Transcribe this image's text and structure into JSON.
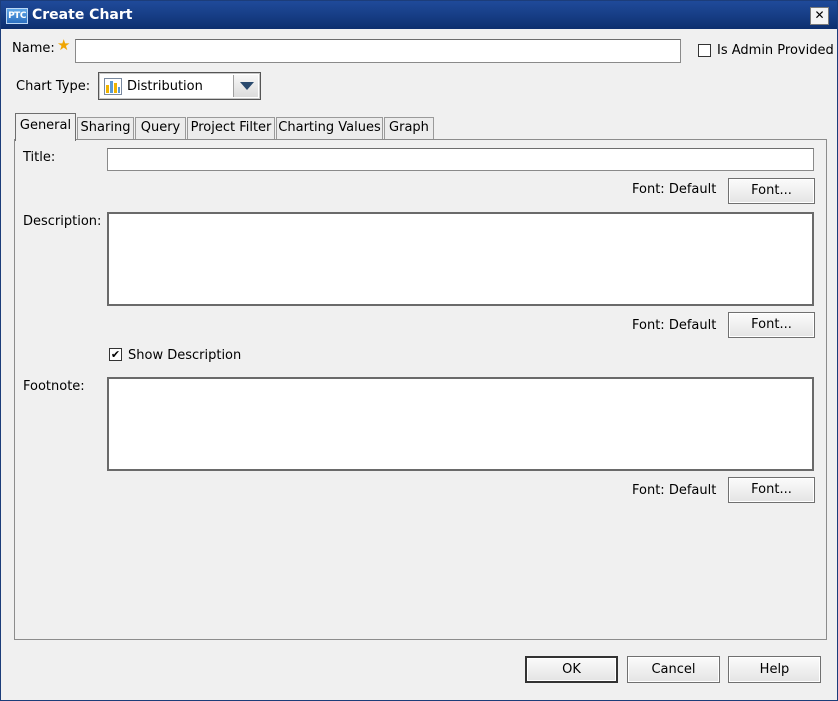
{
  "window": {
    "title": "Create Chart",
    "app_badge": "PTC",
    "close_glyph": "✕"
  },
  "form": {
    "name_label": "Name:",
    "name_value": "",
    "required_star": "★",
    "is_admin_label": "Is Admin Provided",
    "is_admin_checked": false,
    "chart_type_label": "Chart Type:",
    "chart_type_value": "Distribution",
    "chart_type_icon": "bar-chart-icon"
  },
  "tabs": [
    {
      "label": "General",
      "active": true
    },
    {
      "label": "Sharing",
      "active": false
    },
    {
      "label": "Query",
      "active": false
    },
    {
      "label": "Project Filter",
      "active": false
    },
    {
      "label": "Charting Values",
      "active": false
    },
    {
      "label": "Graph",
      "active": false
    }
  ],
  "general": {
    "title_label": "Title:",
    "title_value": "",
    "description_label": "Description:",
    "description_value": "",
    "footnote_label": "Footnote:",
    "footnote_value": "",
    "font_default_label": "Font: Default",
    "font_button_label": "Font...",
    "show_description_label": "Show Description",
    "show_description_checked": true,
    "check_glyph": "✔"
  },
  "footer": {
    "ok_label": "OK",
    "cancel_label": "Cancel",
    "help_label": "Help"
  },
  "colors": {
    "titlebar": "#173e86",
    "star": "#f0a500",
    "panel_bg": "#f0f0f0"
  }
}
